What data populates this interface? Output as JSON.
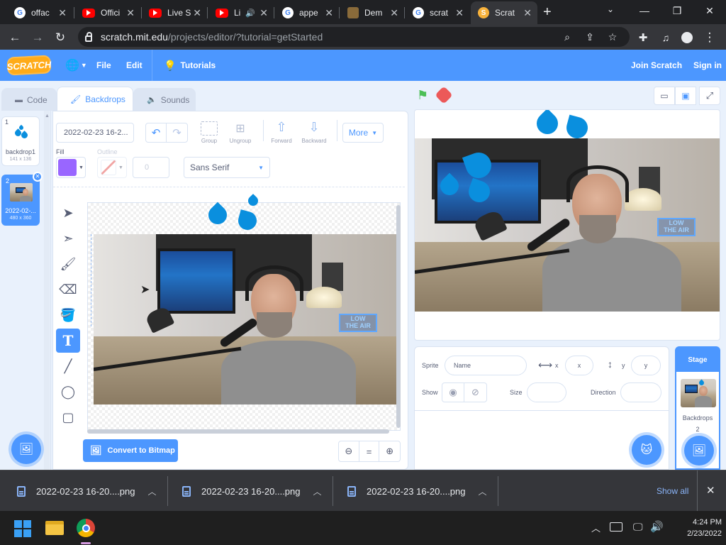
{
  "browser": {
    "tabs": [
      {
        "label": "offac",
        "icon": "google-icon"
      },
      {
        "label": "Offici",
        "icon": "youtube-icon"
      },
      {
        "label": "Live S",
        "icon": "youtube-icon"
      },
      {
        "label": "Li",
        "icon": "youtube-icon"
      },
      {
        "label": "appe",
        "icon": "google-icon"
      },
      {
        "label": "Dem",
        "icon": "cube-icon"
      },
      {
        "label": "scrat",
        "icon": "google-icon"
      },
      {
        "label": "Scrat",
        "icon": "scratch-icon"
      }
    ],
    "url_host": "scratch.mit.edu",
    "url_path": "/projects/editor/?tutorial=getStarted"
  },
  "scratch_menu": {
    "logo": "SCRATCH",
    "file": "File",
    "edit": "Edit",
    "tutorials": "Tutorials",
    "join": "Join Scratch",
    "signin": "Sign in"
  },
  "editor_tabs": {
    "code": "Code",
    "backdrops": "Backdrops",
    "sounds": "Sounds"
  },
  "backdrops": [
    {
      "num": "1",
      "name": "backdrop1",
      "size": "141 x 136"
    },
    {
      "num": "2",
      "name": "2022-02-...",
      "size": "480 x 360"
    }
  ],
  "paint": {
    "costume_name": "2022-02-23 16-2...",
    "group": "Group",
    "ungroup": "Ungroup",
    "forward": "Forward",
    "backward": "Backward",
    "more": "More",
    "fill_label": "Fill",
    "outline_label": "Outline",
    "outline_width": "0",
    "font": "Sans Serif",
    "fill_color": "#9966ff",
    "convert": "Convert to Bitmap",
    "zoom_reset": "="
  },
  "sprite_info": {
    "sprite_label": "Sprite",
    "name_placeholder": "Name",
    "x_label": "x",
    "x_placeholder": "x",
    "y_label": "y",
    "y_placeholder": "y",
    "show_label": "Show",
    "size_label": "Size",
    "direction_label": "Direction"
  },
  "stage_panel": {
    "title": "Stage",
    "backdrops_label": "Backdrops",
    "backdrops_count": "2"
  },
  "downloads": {
    "files": [
      {
        "name": "2022-02-23 16-20....png"
      },
      {
        "name": "2022-02-23 16-20....png"
      },
      {
        "name": "2022-02-23 16-20....png"
      }
    ],
    "show_all": "Show all"
  },
  "taskbar": {
    "time": "4:24 PM",
    "date": "2/23/2022"
  },
  "colors": {
    "scratch_blue": "#4c97ff",
    "go_green": "#4cbf56",
    "stop_red": "#ec5959"
  }
}
